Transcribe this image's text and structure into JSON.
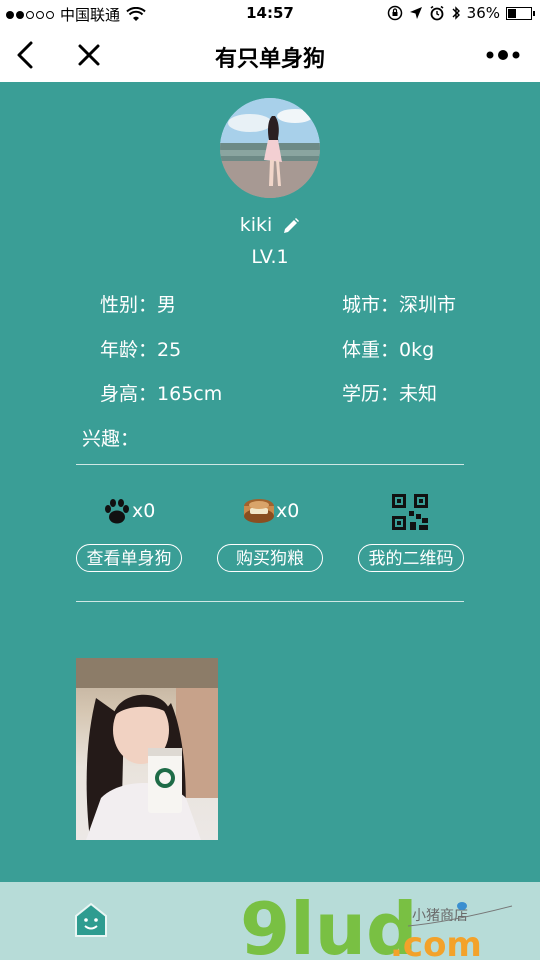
{
  "status_bar": {
    "carrier": "中国联通",
    "time": "14:57",
    "battery": "36%",
    "battery_level": 0.36,
    "icons": [
      "signal-dots-icon",
      "wifi-icon",
      "lock-rotation-icon",
      "location-arrow-icon",
      "alarm-icon",
      "bluetooth-icon",
      "battery-icon"
    ]
  },
  "nav": {
    "title": "有只单身狗",
    "icons": [
      "back-chevron-icon",
      "close-icon",
      "more-dots-icon"
    ]
  },
  "profile": {
    "username": "kiki",
    "level": "LV.1",
    "fields": {
      "gender_label": "性别：",
      "gender_value": "男",
      "city_label": "城市：",
      "city_value": "深圳市",
      "age_label": "年龄：",
      "age_value": "25",
      "weight_label": "体重：",
      "weight_value": "0kg",
      "height_label": "身高：",
      "height_value": "165cm",
      "education_label": "学历：",
      "education_value": "未知",
      "interest_label": "兴趣："
    }
  },
  "actions": {
    "paw_count": "x0",
    "food_count": "x0",
    "view_button": "查看单身狗",
    "buy_button": "购买狗粮",
    "qr_button": "我的二维码",
    "icons": [
      "paw-icon",
      "dog-food-icon",
      "qr-code-icon"
    ]
  },
  "watermark": {
    "brand": "9lud",
    "domain": ".com",
    "tagline": "小猪商店"
  },
  "colors": {
    "background": "#3a9e96",
    "bottom_bar": "#b7dcd8",
    "accent": "#2e9c90"
  }
}
